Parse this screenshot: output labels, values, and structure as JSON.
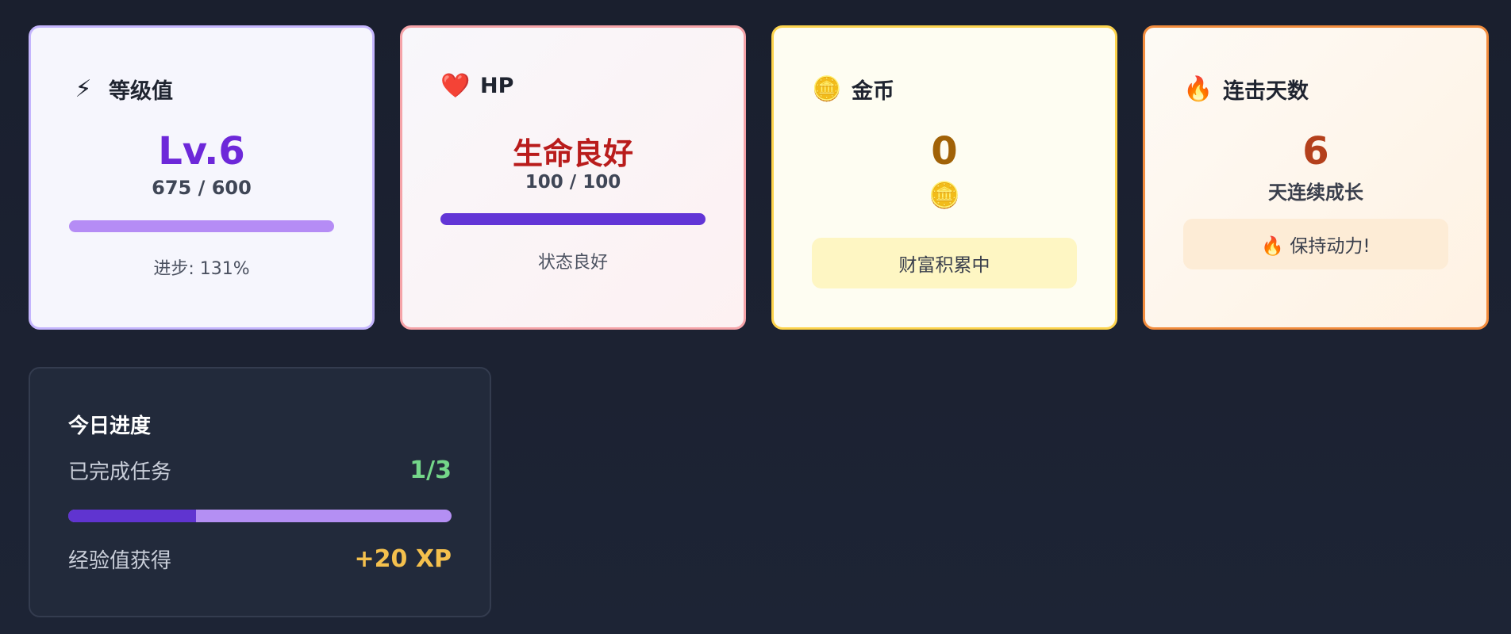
{
  "cards": {
    "level": {
      "icon": "lightning-icon",
      "title": "等级值",
      "value": "Lv.6",
      "sub": "675 / 600",
      "note": "进步: 131%"
    },
    "hp": {
      "icon": "heart-icon",
      "title": "HP",
      "value": "生命良好",
      "sub": "100 / 100",
      "note": "状态良好"
    },
    "coins": {
      "icon": "coin-icon",
      "title": "金币",
      "value": "0",
      "pill": "财富积累中"
    },
    "streak": {
      "icon": "fire-icon",
      "title": "连击天数",
      "value": "6",
      "sub": "天连续成长",
      "pill": "🔥 保持动力!"
    }
  },
  "today": {
    "title": "今日进度",
    "tasks_label": "已完成任务",
    "tasks_value": "1/3",
    "tasks_progress": 0.333,
    "xp_label": "经验值获得",
    "xp_value": "+20 XP"
  },
  "colors": {
    "level_accent": "#6d28d9",
    "hp_accent": "#b91c1c",
    "coin_accent": "#a16207",
    "streak_accent": "#b4401c",
    "tasks_green": "#74d689",
    "xp_gold": "#f4c04d"
  }
}
